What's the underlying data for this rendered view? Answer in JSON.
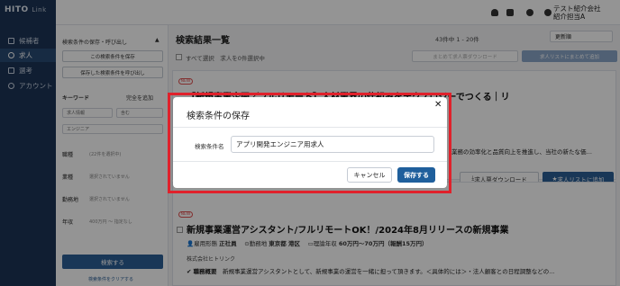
{
  "app": {
    "logo": "HITO",
    "logo_suffix": "Link"
  },
  "sidebar": {
    "items": [
      {
        "label": "候補者",
        "icon": "person-card-icon"
      },
      {
        "label": "求人",
        "icon": "search-icon",
        "active": true
      },
      {
        "label": "選考",
        "icon": "document-icon"
      },
      {
        "label": "アカウント",
        "icon": "user-icon"
      }
    ]
  },
  "topbar": {
    "user_company": "テスト紹介会社",
    "user_name": "紹介担当A"
  },
  "filter": {
    "section_title": "検索条件の保存・呼び出し",
    "save_condition_label": "この検索条件を保存",
    "load_condition_label": "保存した検索条件を呼び出し",
    "keyword_label": "キーワード",
    "keyword_mode": "完全を追加",
    "keyword_scope": "求人情報",
    "keyword_op": "含む",
    "keyword_value": "エンジニア",
    "rows": [
      {
        "label": "職種",
        "value": "(22件を選択中)"
      },
      {
        "label": "業種",
        "value": "選択されていません"
      },
      {
        "label": "勤務地",
        "value": "選択されていません"
      },
      {
        "label": "年収",
        "value": "400万円 〜 指定なし"
      }
    ],
    "search_label": "検索する",
    "clear_label": "検索条件をクリアする"
  },
  "main": {
    "title": "検索結果一覧",
    "count": "43件中 1 - 20件",
    "sort": "更新順",
    "select_all": "すべて選択",
    "select_all_note": "求人を0件選択中",
    "bulk_download": "まとめて求人票ダウンロード",
    "bulk_add": "求人リストにまとめて追加"
  },
  "cards": [
    {
      "badge": "NEW",
      "title": "【新規事業企画／フルリモート】人材業界の仕組みをテクノロジーでつくる｜リ",
      "feature_snippet": "業務の効率化と品質向上を推進し、当社の新たな価…",
      "download_label": "求人票ダウンロード",
      "add_label": "求人リストに追加"
    },
    {
      "badge": "NEW",
      "title": "新規事業運営アシスタント/フルリモートOK！/2024年8月リリースの新規事業",
      "employment_label": "雇用形態",
      "employment": "正社員",
      "location_label": "勤務地",
      "location": "東京都 港区",
      "salary_label": "理論年収",
      "salary": "60万円〜70万円（報酬15万円）",
      "company": "株式会社ヒトリンク",
      "feature_label": "職務概要",
      "feature": "新規事業運営アシスタントとして、新規事業の運営を一緒に担って頂きます。＜具体的には＞・法人顧客との日程調整などの…"
    }
  ],
  "modal": {
    "title": "検索条件の保存",
    "field_label": "検索条件名",
    "field_value": "アプリ開発エンジニア用求人",
    "cancel_label": "キャンセル",
    "save_label": "保存する"
  },
  "colors": {
    "sidebar_bg": "#1c3557",
    "primary": "#1f5f9c",
    "highlight_border": "#e0212b"
  }
}
